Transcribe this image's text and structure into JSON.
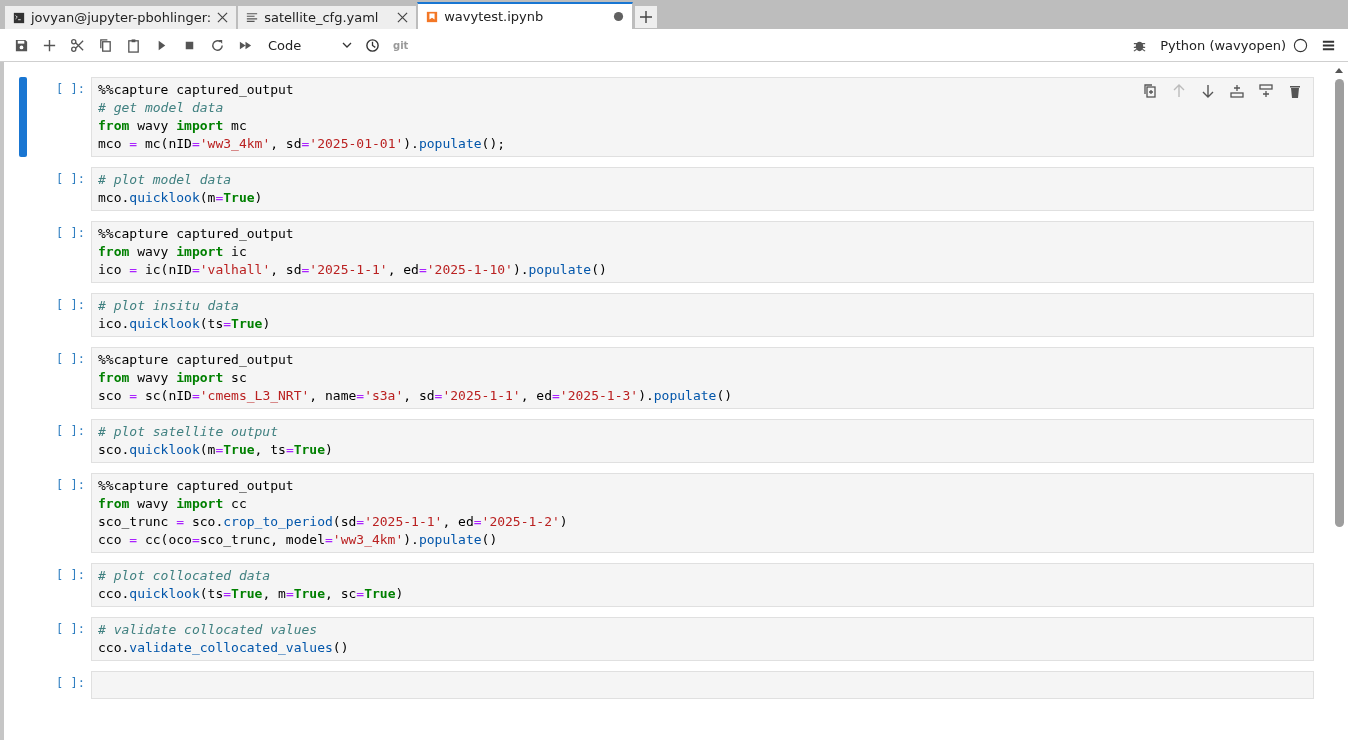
{
  "tabs": [
    {
      "label": "jovyan@jupyter-pbohlinger:",
      "kind": "terminal",
      "selected": false,
      "modified": false
    },
    {
      "label": "satellite_cfg.yaml",
      "kind": "text",
      "selected": false,
      "modified": false
    },
    {
      "label": "wavytest.ipynb",
      "kind": "notebook",
      "selected": true,
      "modified": true
    }
  ],
  "toolbar": {
    "cell_type": "Code",
    "git": "git",
    "kernel": "Python (wavyopen)",
    "kernel_busy": false
  },
  "cells": [
    {
      "prompt": "[ ]:",
      "selected": true,
      "lines": [
        [
          "%%capture captured_output"
        ],
        [
          {
            "kind": "comment",
            "text": "# get model data"
          }
        ],
        [
          {
            "kind": "keyword",
            "text": "from"
          },
          " wavy ",
          {
            "kind": "keyword",
            "text": "import"
          },
          " mc"
        ],
        [
          "mco ",
          {
            "kind": "operator",
            "text": "="
          },
          " mc(nID",
          {
            "kind": "operator",
            "text": "="
          },
          {
            "kind": "string",
            "text": "'ww3_4km'"
          },
          ", sd",
          {
            "kind": "operator",
            "text": "="
          },
          {
            "kind": "string",
            "text": "'2025-01-01'"
          },
          ").",
          {
            "kind": "function",
            "text": "populate"
          },
          "();"
        ]
      ]
    },
    {
      "prompt": "[ ]:",
      "selected": false,
      "lines": [
        [
          {
            "kind": "comment",
            "text": "# plot model data"
          }
        ],
        [
          "mco.",
          {
            "kind": "function",
            "text": "quicklook"
          },
          "(m",
          {
            "kind": "operator",
            "text": "="
          },
          {
            "kind": "keyword",
            "text": "True"
          },
          ")"
        ]
      ]
    },
    {
      "prompt": "[ ]:",
      "selected": false,
      "lines": [
        [
          "%%capture captured_output"
        ],
        [
          {
            "kind": "keyword",
            "text": "from"
          },
          " wavy ",
          {
            "kind": "keyword",
            "text": "import"
          },
          " ic"
        ],
        [
          "ico ",
          {
            "kind": "operator",
            "text": "="
          },
          " ic(nID",
          {
            "kind": "operator",
            "text": "="
          },
          {
            "kind": "string",
            "text": "'valhall'"
          },
          ", sd",
          {
            "kind": "operator",
            "text": "="
          },
          {
            "kind": "string",
            "text": "'2025-1-1'"
          },
          ", ed",
          {
            "kind": "operator",
            "text": "="
          },
          {
            "kind": "string",
            "text": "'2025-1-10'"
          },
          ").",
          {
            "kind": "function",
            "text": "populate"
          },
          "()"
        ]
      ]
    },
    {
      "prompt": "[ ]:",
      "selected": false,
      "lines": [
        [
          {
            "kind": "comment",
            "text": "# plot insitu data"
          }
        ],
        [
          "ico.",
          {
            "kind": "function",
            "text": "quicklook"
          },
          "(ts",
          {
            "kind": "operator",
            "text": "="
          },
          {
            "kind": "keyword",
            "text": "True"
          },
          ")"
        ]
      ]
    },
    {
      "prompt": "[ ]:",
      "selected": false,
      "lines": [
        [
          "%%capture captured_output"
        ],
        [
          {
            "kind": "keyword",
            "text": "from"
          },
          " wavy ",
          {
            "kind": "keyword",
            "text": "import"
          },
          " sc"
        ],
        [
          "sco ",
          {
            "kind": "operator",
            "text": "="
          },
          " sc(nID",
          {
            "kind": "operator",
            "text": "="
          },
          {
            "kind": "string",
            "text": "'cmems_L3_NRT'"
          },
          ", name",
          {
            "kind": "operator",
            "text": "="
          },
          {
            "kind": "string",
            "text": "'s3a'"
          },
          ", sd",
          {
            "kind": "operator",
            "text": "="
          },
          {
            "kind": "string",
            "text": "'2025-1-1'"
          },
          ", ed",
          {
            "kind": "operator",
            "text": "="
          },
          {
            "kind": "string",
            "text": "'2025-1-3'"
          },
          ").",
          {
            "kind": "function",
            "text": "populate"
          },
          "()"
        ]
      ]
    },
    {
      "prompt": "[ ]:",
      "selected": false,
      "lines": [
        [
          {
            "kind": "comment",
            "text": "# plot satellite output"
          }
        ],
        [
          "sco.",
          {
            "kind": "function",
            "text": "quicklook"
          },
          "(m",
          {
            "kind": "operator",
            "text": "="
          },
          {
            "kind": "keyword",
            "text": "True"
          },
          ", ts",
          {
            "kind": "operator",
            "text": "="
          },
          {
            "kind": "keyword",
            "text": "True"
          },
          ")"
        ]
      ]
    },
    {
      "prompt": "[ ]:",
      "selected": false,
      "lines": [
        [
          "%%capture captured_output"
        ],
        [
          {
            "kind": "keyword",
            "text": "from"
          },
          " wavy ",
          {
            "kind": "keyword",
            "text": "import"
          },
          " cc"
        ],
        [
          "sco_trunc ",
          {
            "kind": "operator",
            "text": "="
          },
          " sco.",
          {
            "kind": "function",
            "text": "crop_to_period"
          },
          "(sd",
          {
            "kind": "operator",
            "text": "="
          },
          {
            "kind": "string",
            "text": "'2025-1-1'"
          },
          ", ed",
          {
            "kind": "operator",
            "text": "="
          },
          {
            "kind": "string",
            "text": "'2025-1-2'"
          },
          ")"
        ],
        [
          "cco ",
          {
            "kind": "operator",
            "text": "="
          },
          " cc(oco",
          {
            "kind": "operator",
            "text": "="
          },
          "sco_trunc, model",
          {
            "kind": "operator",
            "text": "="
          },
          {
            "kind": "string",
            "text": "'ww3_4km'"
          },
          ").",
          {
            "kind": "function",
            "text": "populate"
          },
          "()"
        ]
      ]
    },
    {
      "prompt": "[ ]:",
      "selected": false,
      "lines": [
        [
          {
            "kind": "comment",
            "text": "# plot collocated data"
          }
        ],
        [
          "cco.",
          {
            "kind": "function",
            "text": "quicklook"
          },
          "(ts",
          {
            "kind": "operator",
            "text": "="
          },
          {
            "kind": "keyword",
            "text": "True"
          },
          ", m",
          {
            "kind": "operator",
            "text": "="
          },
          {
            "kind": "keyword",
            "text": "True"
          },
          ", sc",
          {
            "kind": "operator",
            "text": "="
          },
          {
            "kind": "keyword",
            "text": "True"
          },
          ")"
        ]
      ]
    },
    {
      "prompt": "[ ]:",
      "selected": false,
      "lines": [
        [
          {
            "kind": "comment",
            "text": "# validate collocated values"
          }
        ],
        [
          "cco.",
          {
            "kind": "function",
            "text": "validate_collocated_values"
          },
          "()"
        ]
      ]
    },
    {
      "prompt": "[ ]:",
      "selected": false
    }
  ]
}
